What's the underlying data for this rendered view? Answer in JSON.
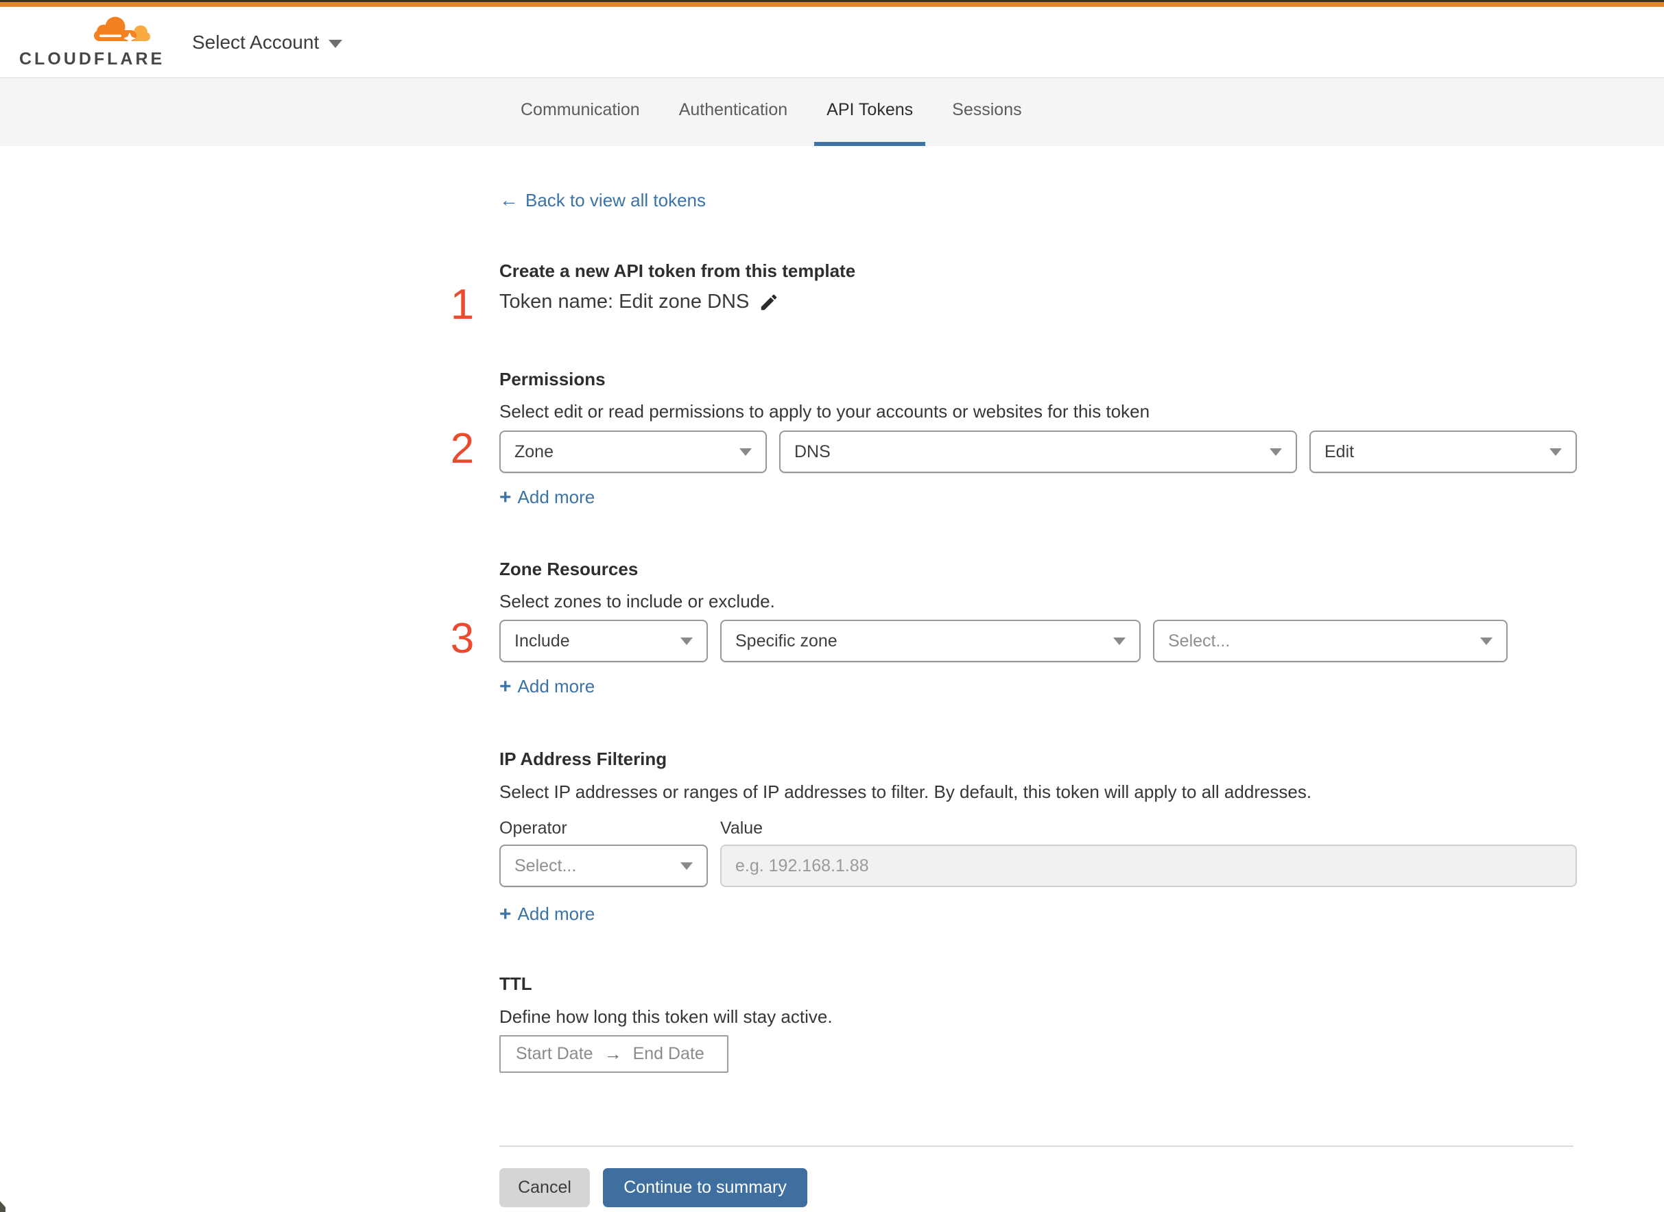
{
  "header": {
    "logo_text": "CLOUDFLARE",
    "account_selector_label": "Select Account"
  },
  "tabs": [
    {
      "label": "Communication"
    },
    {
      "label": "Authentication"
    },
    {
      "label": "API Tokens"
    },
    {
      "label": "Sessions"
    }
  ],
  "active_tab": "API Tokens",
  "back_link": {
    "label": "Back to view all tokens"
  },
  "steps": {
    "one": "1",
    "two": "2",
    "three": "3"
  },
  "template_section": {
    "heading": "Create a new API token from this template",
    "token_name": "Token name: Edit zone DNS"
  },
  "permissions": {
    "heading": "Permissions",
    "description": "Select edit or read permissions to apply to your accounts or websites for this token",
    "scope_value": "Zone",
    "service_value": "DNS",
    "access_value": "Edit",
    "add_more": "Add more"
  },
  "zone_resources": {
    "heading": "Zone Resources",
    "description": "Select zones to include or exclude.",
    "operator_value": "Include",
    "type_value": "Specific zone",
    "zone_placeholder": "Select...",
    "add_more": "Add more"
  },
  "ip_filtering": {
    "heading": "IP Address Filtering",
    "description": "Select IP addresses or ranges of IP addresses to filter. By default, this token will apply to all addresses.",
    "operator_label": "Operator",
    "value_label": "Value",
    "operator_placeholder": "Select...",
    "value_placeholder": "e.g. 192.168.1.88",
    "add_more": "Add more"
  },
  "ttl": {
    "heading": "TTL",
    "description": "Define how long this token will stay active.",
    "start_label": "Start Date",
    "end_label": "End Date"
  },
  "footer": {
    "cancel": "Cancel",
    "continue": "Continue to summary"
  },
  "icons": {
    "plus": "+",
    "back_arrow": "←",
    "range_arrow": "→"
  },
  "colors": {
    "accent_blue": "#3b73a8",
    "brand_orange": "#f48120",
    "brand_orange_light": "#f9ab41",
    "topbar_orange": "#e0862d",
    "step_number_red": "#ea4b2f",
    "tab_underline": "#3f73a6",
    "continue_button": "#3e6f9e"
  }
}
